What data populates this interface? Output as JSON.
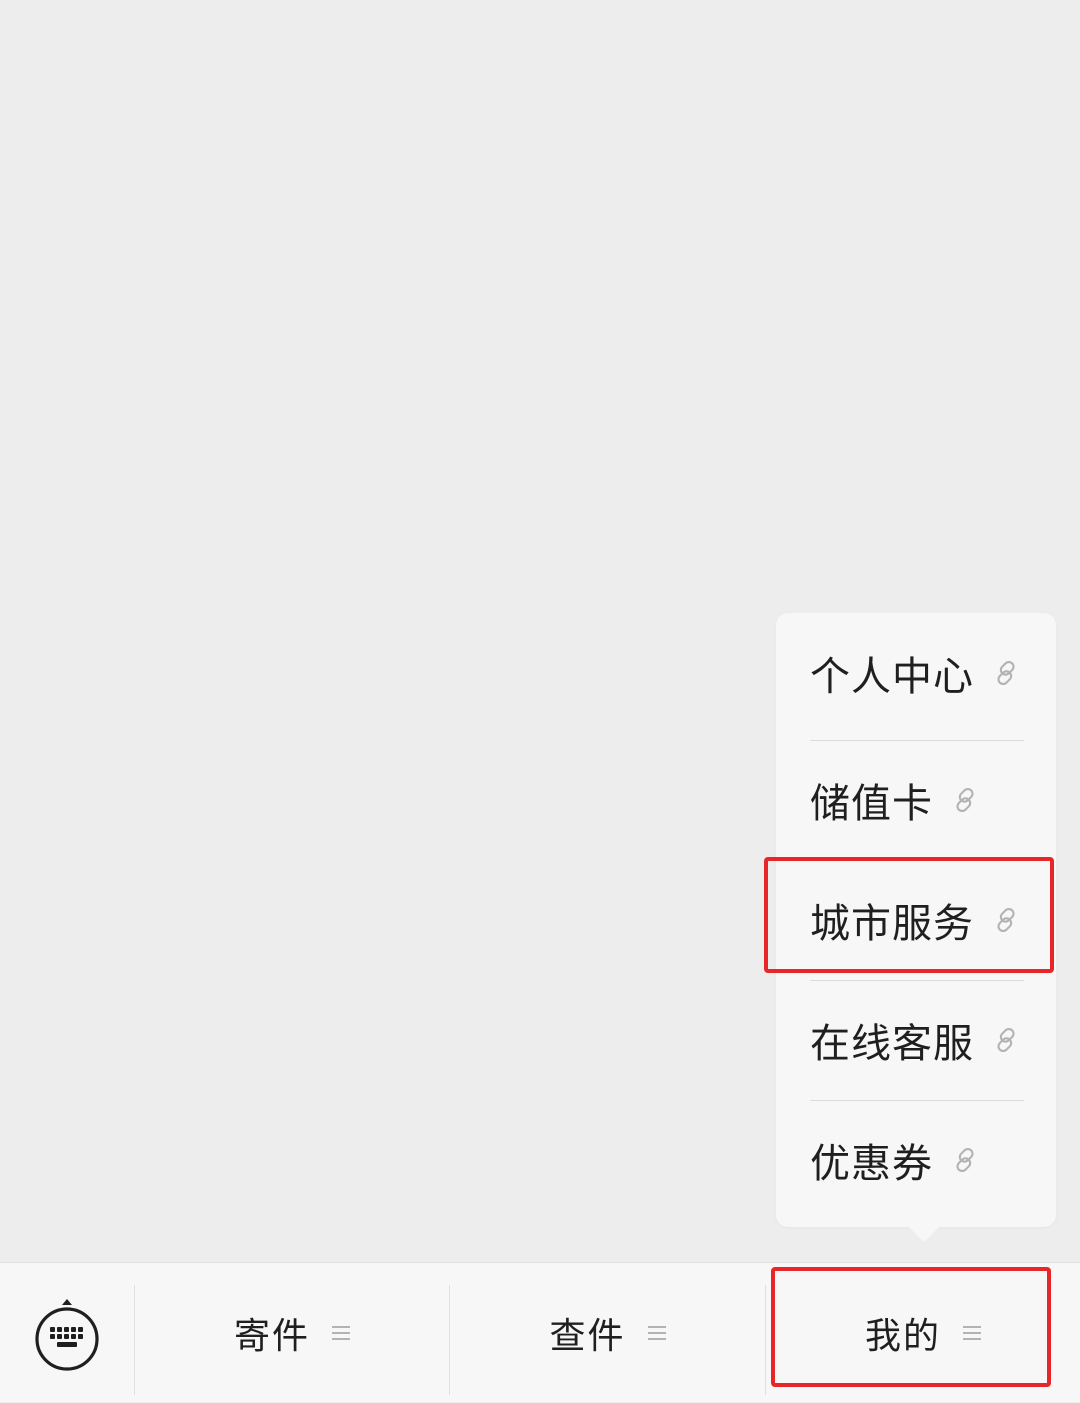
{
  "submenu": {
    "items": [
      {
        "label": "个人中心",
        "icon": "link-icon"
      },
      {
        "label": "储值卡",
        "icon": "link-icon"
      },
      {
        "label": "城市服务",
        "icon": "link-icon"
      },
      {
        "label": "在线客服",
        "icon": "link-icon"
      },
      {
        "label": "优惠券",
        "icon": "link-icon"
      }
    ]
  },
  "menu_bar": {
    "keyboard_icon": "keyboard-icon",
    "tabs": [
      {
        "label": "寄件",
        "icon": "menu-lines-icon"
      },
      {
        "label": "查件",
        "icon": "menu-lines-icon"
      },
      {
        "label": "我的",
        "icon": "menu-lines-icon"
      }
    ]
  },
  "colors": {
    "background": "#ededed",
    "menu_background": "#f7f7f7",
    "highlight": "#e8262a",
    "text": "#1f1f1f",
    "icon_gray": "#b3b3b3"
  }
}
